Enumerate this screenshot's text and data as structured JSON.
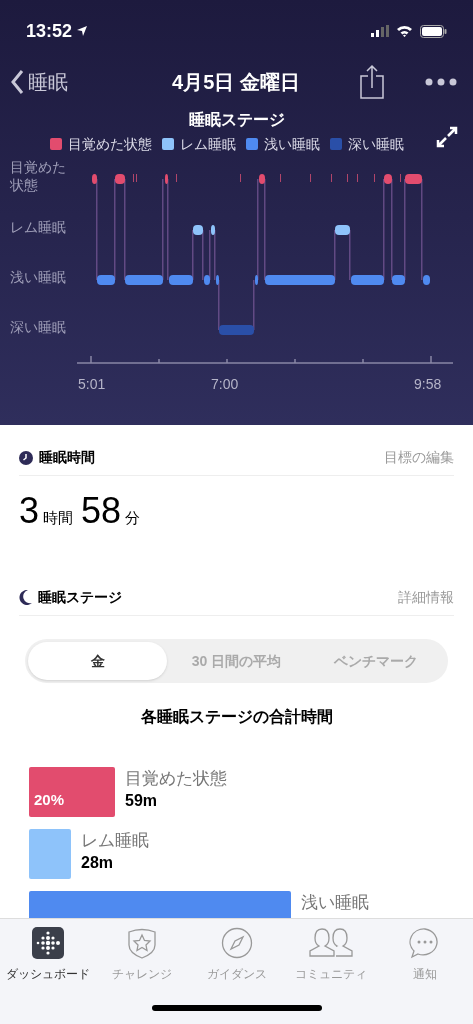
{
  "status_bar": {
    "time": "13:52"
  },
  "nav": {
    "back_label": "睡眠",
    "title": "4月5日 金曜日"
  },
  "hypnogram": {
    "title": "睡眠ステージ",
    "legend": [
      {
        "label": "目覚めた状態",
        "color": "#e24c6e"
      },
      {
        "label": "レム睡眠",
        "color": "#8ec3fa"
      },
      {
        "label": "浅い睡眠",
        "color": "#4f8af0"
      },
      {
        "label": "深い睡眠",
        "color": "#2a4fa8"
      }
    ],
    "y_labels": [
      "目覚めた状態",
      "レム睡眠",
      "浅い睡眠",
      "深い睡眠"
    ],
    "x_labels": [
      "5:01",
      "7:00",
      "9:58"
    ]
  },
  "duration_section": {
    "title": "睡眠時間",
    "action": "目標の編集",
    "hours": "3",
    "hours_unit": "時間",
    "minutes": "58",
    "minutes_unit": "分"
  },
  "stages_section": {
    "title": "睡眠ステージ",
    "action": "詳細情報",
    "tabs": [
      {
        "label": "金",
        "selected": true
      },
      {
        "label": "30 日間の平均",
        "selected": false
      },
      {
        "label": "ベンチマーク",
        "selected": false
      }
    ],
    "chart_title": "各睡眠ステージの合計時間",
    "bars": [
      {
        "label": "目覚めた状態",
        "duration": "59m",
        "percent": "20%",
        "color": "#e24c6e"
      },
      {
        "label": "レム睡眠",
        "duration": "28m",
        "color": "#8ec3fa"
      },
      {
        "label": "浅い睡眠",
        "color": "#4f8af0"
      }
    ]
  },
  "tab_bar": [
    {
      "label": "ダッシュボード",
      "kind": "dashboard",
      "selected": true
    },
    {
      "label": "チャレンジ",
      "kind": "challenge",
      "selected": false
    },
    {
      "label": "ガイダンス",
      "kind": "guidance",
      "selected": false
    },
    {
      "label": "コミュニティ",
      "kind": "community",
      "selected": false
    },
    {
      "label": "通知",
      "kind": "notifications",
      "selected": false
    }
  ]
}
